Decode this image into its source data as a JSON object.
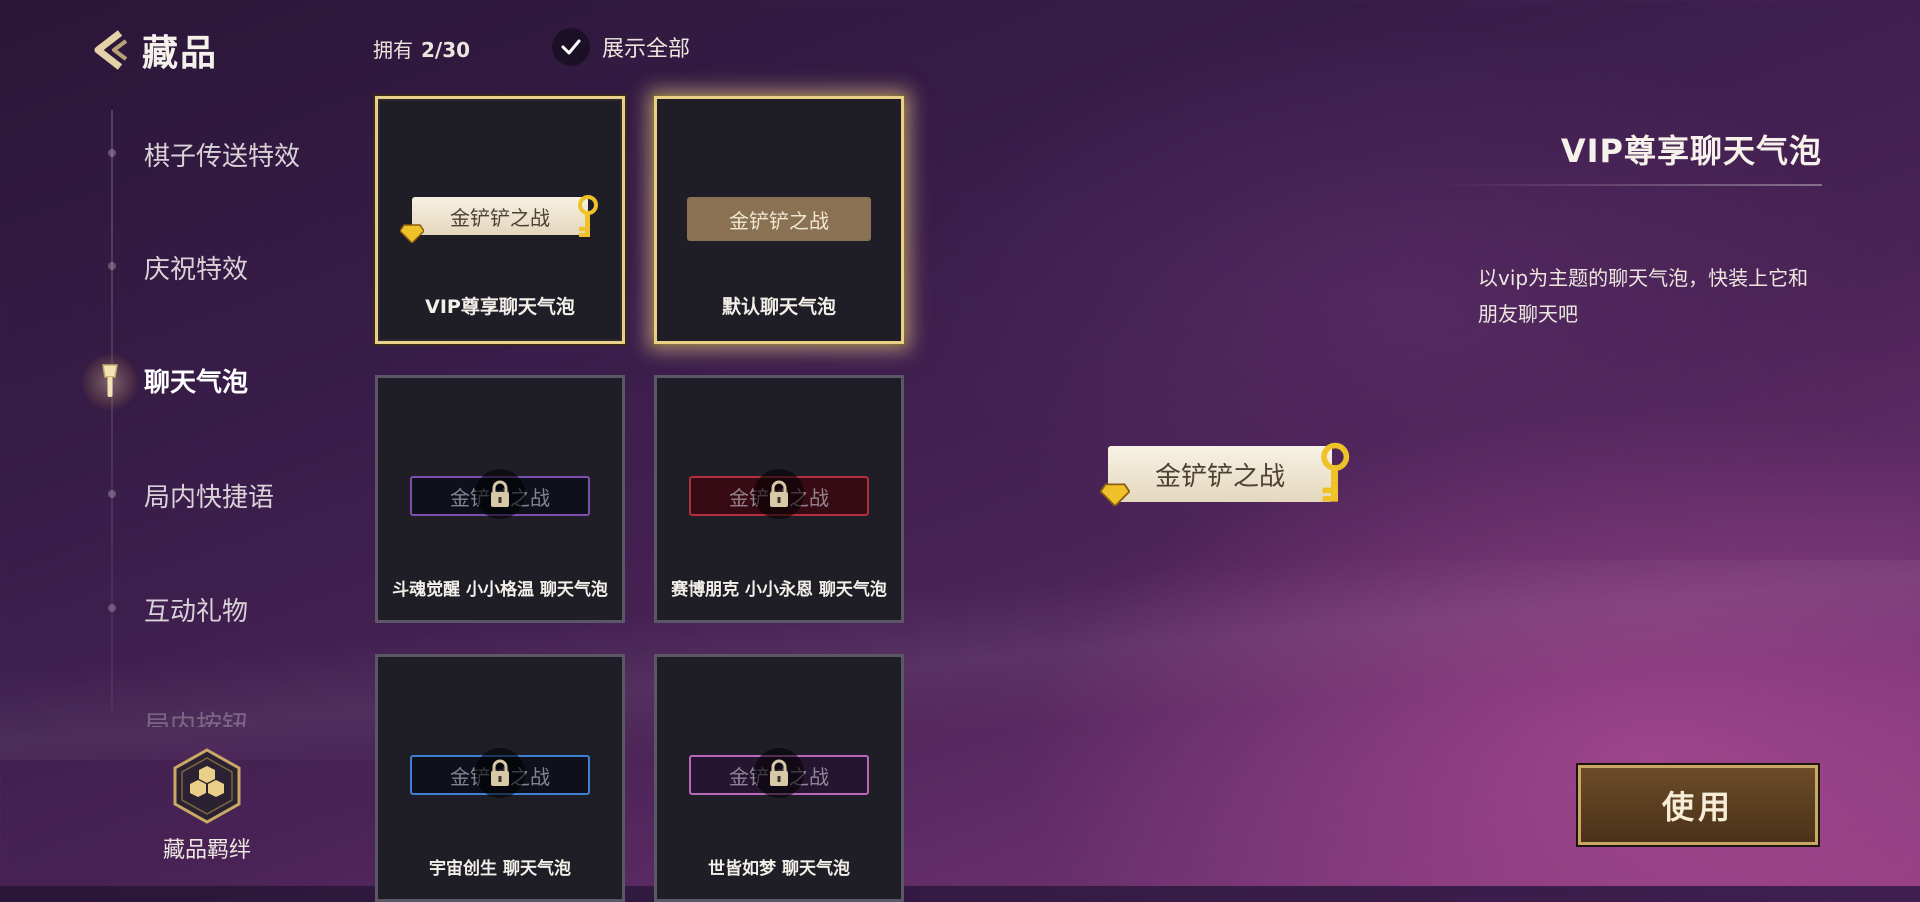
{
  "header": {
    "title": "藏品",
    "owned_label": "拥有",
    "owned_count": "2/30",
    "show_all_label": "展示全部"
  },
  "nav": {
    "items": [
      {
        "label": "棋子传送特效"
      },
      {
        "label": "庆祝特效"
      },
      {
        "label": "聊天气泡"
      },
      {
        "label": "局内快捷语"
      },
      {
        "label": "互动礼物"
      },
      {
        "label": "局内按钮"
      }
    ],
    "active_index": 2,
    "collection_bond_label": "藏品羁绊"
  },
  "grid": {
    "bubble_text": "金铲铲之战",
    "items": [
      {
        "name": "VIP尊享聊天气泡",
        "owned": true,
        "selected": false,
        "style": "vip"
      },
      {
        "name": "默认聊天气泡",
        "owned": true,
        "selected": true,
        "style": "default"
      },
      {
        "name": "斗魂觉醒  小小格温  聊天气泡",
        "owned": false,
        "style": "skin",
        "frame_color": "#7a4fb0"
      },
      {
        "name": "赛博朋克  小小永恩  聊天气泡",
        "owned": false,
        "style": "skin",
        "frame_color": "#b03040"
      },
      {
        "name": "宇宙创生  聊天气泡",
        "owned": false,
        "style": "skin",
        "frame_color": "#3f7fd0"
      },
      {
        "name": "世皆如梦  聊天气泡",
        "owned": false,
        "style": "skin",
        "frame_color": "#b868b8"
      }
    ]
  },
  "detail": {
    "title": "VIP尊享聊天气泡",
    "description": "以vip为主题的聊天气泡，快装上它和朋友聊天吧",
    "preview_text": "金铲铲之战",
    "use_button": "使用"
  },
  "colors": {
    "gold_border": "#e9cf87",
    "card_bg": "#1f1e27",
    "button_bg": "#5b3f22"
  }
}
